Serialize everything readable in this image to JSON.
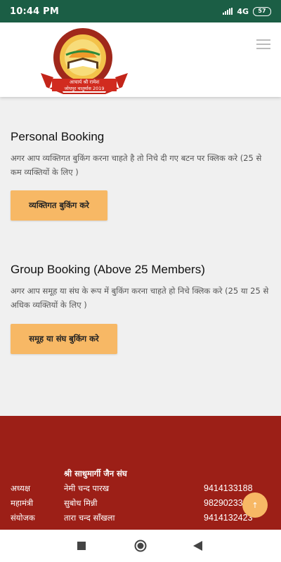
{
  "status_bar": {
    "time": "10:44 PM",
    "network": "4G",
    "battery": "57"
  },
  "header": {
    "logo_alt": "आचार्य श्री रामेश जोधपुर चातुर्मास 2019"
  },
  "personal_booking": {
    "title": "Personal Booking",
    "description": "अगर आप व्यक्तिगत बुकिंग करना चाहते है तो निचे दी गए बटन पर क्लिक करे (25 से कम व्यक्तियों के लिए )",
    "button_label": "व्यक्तिगत बुकिंग करे"
  },
  "group_booking": {
    "title": "Group Booking (Above 25 Members)",
    "description": "अगर आप समूह या संघ के रूप में बुकिंग करना चाहते हो निचे क्लिक करे (25 या 25 से अधिक व्यक्तियों के लिए )",
    "button_label": "समूह या संघ बुकिंग करे"
  },
  "footer": {
    "heading": "श्री साधुमार्गी जैन संघ",
    "contacts": [
      {
        "role": "अध्यक्ष",
        "name": "नेमी चन्द पारख",
        "phone": "9414133188"
      },
      {
        "role": "महामंत्री",
        "name": "सुबोध मिन्नी",
        "phone": "98290233"
      },
      {
        "role": "संयोजक",
        "name": "तारा चन्द साँखला",
        "phone": "9414132423"
      }
    ]
  },
  "scroll_top": {
    "label": "↑"
  },
  "colors": {
    "status_bar": "#1b5e45",
    "button": "#f7b865",
    "footer": "#9c1f17",
    "background": "#f0f0f0"
  },
  "icons": {
    "menu": "hamburger-menu-icon",
    "signal": "signal-icon",
    "battery": "battery-icon",
    "nav_back": "back-triangle-icon",
    "nav_home": "home-circle-icon",
    "nav_recent": "recent-square-icon"
  }
}
